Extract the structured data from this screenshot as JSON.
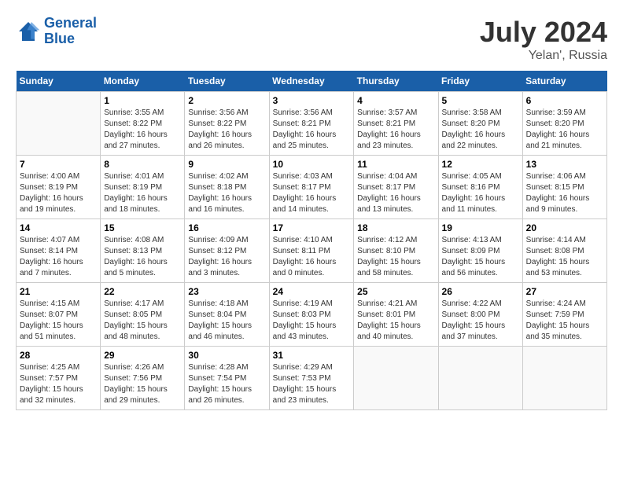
{
  "header": {
    "logo_line1": "General",
    "logo_line2": "Blue",
    "month_title": "July 2024",
    "subtitle": "Yelan', Russia"
  },
  "weekdays": [
    "Sunday",
    "Monday",
    "Tuesday",
    "Wednesday",
    "Thursday",
    "Friday",
    "Saturday"
  ],
  "weeks": [
    [
      {
        "day": "",
        "sunrise": "",
        "sunset": "",
        "daylight": ""
      },
      {
        "day": "1",
        "sunrise": "Sunrise: 3:55 AM",
        "sunset": "Sunset: 8:22 PM",
        "daylight": "Daylight: 16 hours and 27 minutes."
      },
      {
        "day": "2",
        "sunrise": "Sunrise: 3:56 AM",
        "sunset": "Sunset: 8:22 PM",
        "daylight": "Daylight: 16 hours and 26 minutes."
      },
      {
        "day": "3",
        "sunrise": "Sunrise: 3:56 AM",
        "sunset": "Sunset: 8:21 PM",
        "daylight": "Daylight: 16 hours and 25 minutes."
      },
      {
        "day": "4",
        "sunrise": "Sunrise: 3:57 AM",
        "sunset": "Sunset: 8:21 PM",
        "daylight": "Daylight: 16 hours and 23 minutes."
      },
      {
        "day": "5",
        "sunrise": "Sunrise: 3:58 AM",
        "sunset": "Sunset: 8:20 PM",
        "daylight": "Daylight: 16 hours and 22 minutes."
      },
      {
        "day": "6",
        "sunrise": "Sunrise: 3:59 AM",
        "sunset": "Sunset: 8:20 PM",
        "daylight": "Daylight: 16 hours and 21 minutes."
      }
    ],
    [
      {
        "day": "7",
        "sunrise": "Sunrise: 4:00 AM",
        "sunset": "Sunset: 8:19 PM",
        "daylight": "Daylight: 16 hours and 19 minutes."
      },
      {
        "day": "8",
        "sunrise": "Sunrise: 4:01 AM",
        "sunset": "Sunset: 8:19 PM",
        "daylight": "Daylight: 16 hours and 18 minutes."
      },
      {
        "day": "9",
        "sunrise": "Sunrise: 4:02 AM",
        "sunset": "Sunset: 8:18 PM",
        "daylight": "Daylight: 16 hours and 16 minutes."
      },
      {
        "day": "10",
        "sunrise": "Sunrise: 4:03 AM",
        "sunset": "Sunset: 8:17 PM",
        "daylight": "Daylight: 16 hours and 14 minutes."
      },
      {
        "day": "11",
        "sunrise": "Sunrise: 4:04 AM",
        "sunset": "Sunset: 8:17 PM",
        "daylight": "Daylight: 16 hours and 13 minutes."
      },
      {
        "day": "12",
        "sunrise": "Sunrise: 4:05 AM",
        "sunset": "Sunset: 8:16 PM",
        "daylight": "Daylight: 16 hours and 11 minutes."
      },
      {
        "day": "13",
        "sunrise": "Sunrise: 4:06 AM",
        "sunset": "Sunset: 8:15 PM",
        "daylight": "Daylight: 16 hours and 9 minutes."
      }
    ],
    [
      {
        "day": "14",
        "sunrise": "Sunrise: 4:07 AM",
        "sunset": "Sunset: 8:14 PM",
        "daylight": "Daylight: 16 hours and 7 minutes."
      },
      {
        "day": "15",
        "sunrise": "Sunrise: 4:08 AM",
        "sunset": "Sunset: 8:13 PM",
        "daylight": "Daylight: 16 hours and 5 minutes."
      },
      {
        "day": "16",
        "sunrise": "Sunrise: 4:09 AM",
        "sunset": "Sunset: 8:12 PM",
        "daylight": "Daylight: 16 hours and 3 minutes."
      },
      {
        "day": "17",
        "sunrise": "Sunrise: 4:10 AM",
        "sunset": "Sunset: 8:11 PM",
        "daylight": "Daylight: 16 hours and 0 minutes."
      },
      {
        "day": "18",
        "sunrise": "Sunrise: 4:12 AM",
        "sunset": "Sunset: 8:10 PM",
        "daylight": "Daylight: 15 hours and 58 minutes."
      },
      {
        "day": "19",
        "sunrise": "Sunrise: 4:13 AM",
        "sunset": "Sunset: 8:09 PM",
        "daylight": "Daylight: 15 hours and 56 minutes."
      },
      {
        "day": "20",
        "sunrise": "Sunrise: 4:14 AM",
        "sunset": "Sunset: 8:08 PM",
        "daylight": "Daylight: 15 hours and 53 minutes."
      }
    ],
    [
      {
        "day": "21",
        "sunrise": "Sunrise: 4:15 AM",
        "sunset": "Sunset: 8:07 PM",
        "daylight": "Daylight: 15 hours and 51 minutes."
      },
      {
        "day": "22",
        "sunrise": "Sunrise: 4:17 AM",
        "sunset": "Sunset: 8:05 PM",
        "daylight": "Daylight: 15 hours and 48 minutes."
      },
      {
        "day": "23",
        "sunrise": "Sunrise: 4:18 AM",
        "sunset": "Sunset: 8:04 PM",
        "daylight": "Daylight: 15 hours and 46 minutes."
      },
      {
        "day": "24",
        "sunrise": "Sunrise: 4:19 AM",
        "sunset": "Sunset: 8:03 PM",
        "daylight": "Daylight: 15 hours and 43 minutes."
      },
      {
        "day": "25",
        "sunrise": "Sunrise: 4:21 AM",
        "sunset": "Sunset: 8:01 PM",
        "daylight": "Daylight: 15 hours and 40 minutes."
      },
      {
        "day": "26",
        "sunrise": "Sunrise: 4:22 AM",
        "sunset": "Sunset: 8:00 PM",
        "daylight": "Daylight: 15 hours and 37 minutes."
      },
      {
        "day": "27",
        "sunrise": "Sunrise: 4:24 AM",
        "sunset": "Sunset: 7:59 PM",
        "daylight": "Daylight: 15 hours and 35 minutes."
      }
    ],
    [
      {
        "day": "28",
        "sunrise": "Sunrise: 4:25 AM",
        "sunset": "Sunset: 7:57 PM",
        "daylight": "Daylight: 15 hours and 32 minutes."
      },
      {
        "day": "29",
        "sunrise": "Sunrise: 4:26 AM",
        "sunset": "Sunset: 7:56 PM",
        "daylight": "Daylight: 15 hours and 29 minutes."
      },
      {
        "day": "30",
        "sunrise": "Sunrise: 4:28 AM",
        "sunset": "Sunset: 7:54 PM",
        "daylight": "Daylight: 15 hours and 26 minutes."
      },
      {
        "day": "31",
        "sunrise": "Sunrise: 4:29 AM",
        "sunset": "Sunset: 7:53 PM",
        "daylight": "Daylight: 15 hours and 23 minutes."
      },
      {
        "day": "",
        "sunrise": "",
        "sunset": "",
        "daylight": ""
      },
      {
        "day": "",
        "sunrise": "",
        "sunset": "",
        "daylight": ""
      },
      {
        "day": "",
        "sunrise": "",
        "sunset": "",
        "daylight": ""
      }
    ]
  ]
}
